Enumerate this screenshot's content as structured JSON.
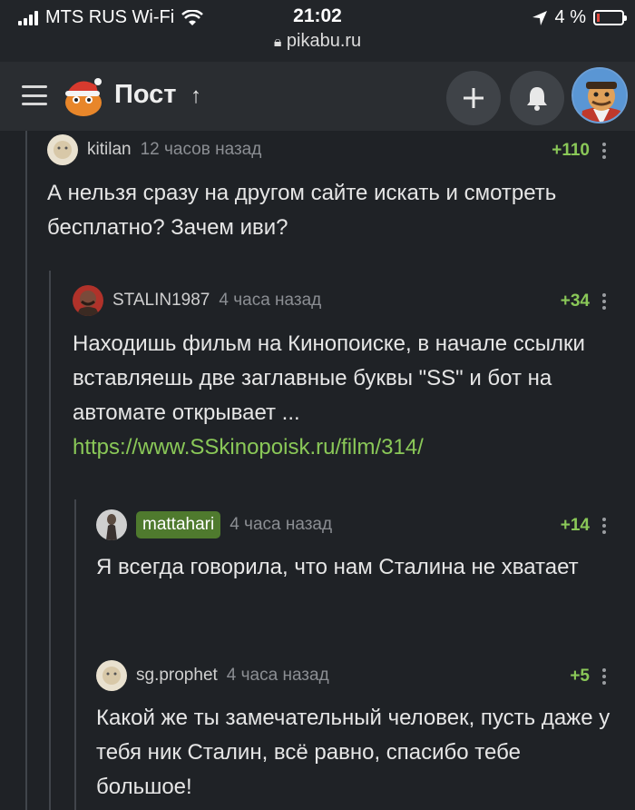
{
  "status_bar": {
    "carrier": "MTS RUS Wi-Fi",
    "time": "21:02",
    "url": "pikabu.ru",
    "battery": "4 %"
  },
  "header": {
    "title": "Пост"
  },
  "comments": [
    {
      "nick": "kitilan",
      "time": "12 часов назад",
      "rating": "+110",
      "text": "А нельзя сразу на другом сайте искать и смотреть бесплатно? Зачем иви?"
    },
    {
      "nick": "STALIN1987",
      "time": "4 часа назад",
      "rating": "+34",
      "text": "Находишь фильм на Кинопоиске, в начале ссылки вставляешь две заглавные буквы \"SS\" и бот на автомате открывает ...",
      "link": "https://www.SSkinopoisk.ru/film/314/"
    },
    {
      "nick": "mattahari",
      "time": "4 часа назад",
      "rating": "+14",
      "text": "Я всегда говорила, что нам Сталина не хватает"
    },
    {
      "nick": "sg.prophet",
      "time": "4 часа назад",
      "rating": "+5",
      "text": "Какой же ты замечательный человек, пусть даже у тебя ник Сталин, всё равно, спасибо тебе большое!"
    }
  ],
  "colors": {
    "background": "#1f2226",
    "rating_green": "#8ac858",
    "badge_green": "#4f7a2e"
  }
}
